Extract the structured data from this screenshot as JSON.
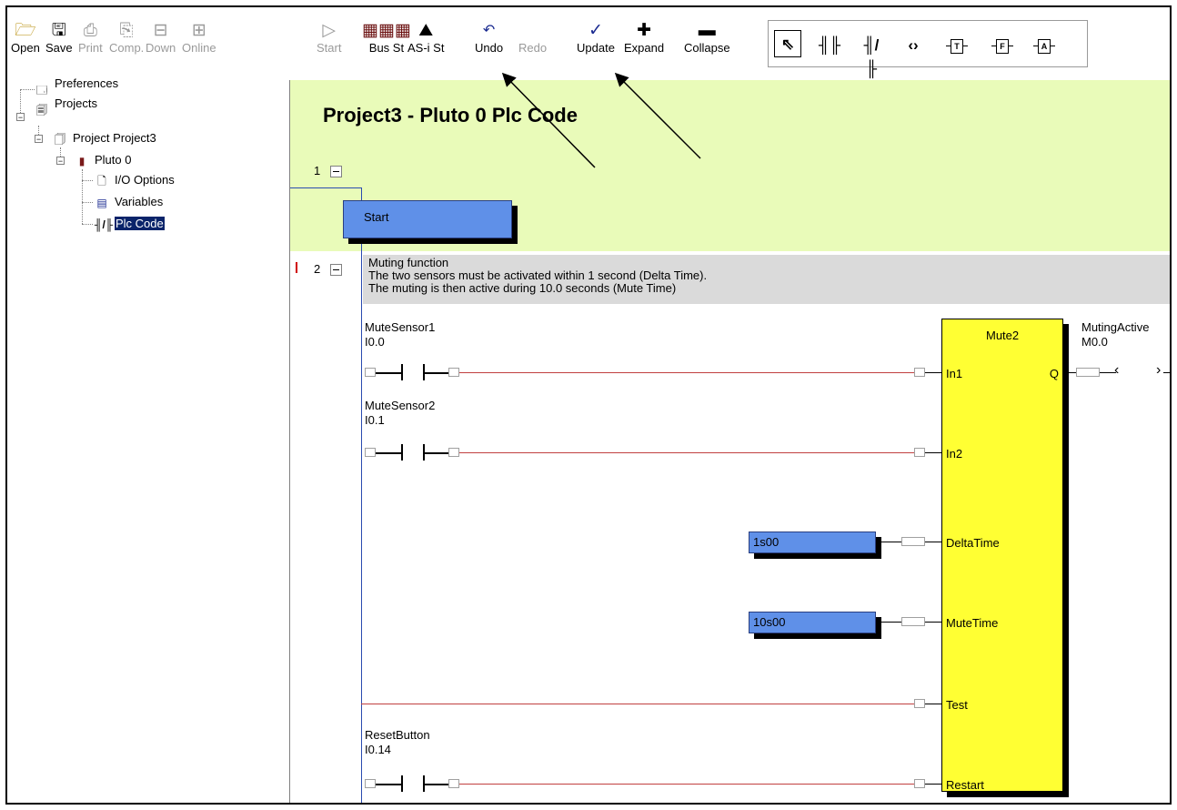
{
  "toolbar": {
    "buttons": [
      {
        "label": "Open",
        "icon": "folder-open-icon",
        "enabled": true
      },
      {
        "label": "Save",
        "icon": "floppy-disk-icon",
        "enabled": true
      },
      {
        "label": "Print",
        "icon": "printer-icon",
        "enabled": false
      },
      {
        "label": "Comp.",
        "icon": "compile-icon",
        "enabled": false
      },
      {
        "label": "Down",
        "icon": "download-icon",
        "enabled": false
      },
      {
        "label": "Online",
        "icon": "online-icon",
        "enabled": false
      },
      {
        "label": "Start",
        "icon": "play-icon",
        "enabled": false
      },
      {
        "label": "Bus St",
        "icon": "bus-status-icon",
        "enabled": true
      },
      {
        "label": "AS-i St",
        "icon": "asi-status-icon",
        "enabled": true
      },
      {
        "label": "Undo",
        "icon": "undo-icon",
        "enabled": true
      },
      {
        "label": "Redo",
        "icon": "redo-icon",
        "enabled": false
      },
      {
        "label": "Update",
        "icon": "checkmark-icon",
        "enabled": true
      },
      {
        "label": "Expand",
        "icon": "plus-icon",
        "enabled": true
      },
      {
        "label": "Collapse",
        "icon": "minus-icon",
        "enabled": true
      }
    ],
    "edit_tools": [
      {
        "name": "pointer-tool-icon",
        "glyph": "⇖"
      },
      {
        "name": "normally-open-contact-icon",
        "glyph": "┫┣"
      },
      {
        "name": "normally-closed-contact-icon",
        "glyph": "┫/┣"
      },
      {
        "name": "coil-icon",
        "glyph": "‹ ›"
      },
      {
        "name": "timer-block-icon",
        "glyph": "T"
      },
      {
        "name": "function-block-icon",
        "glyph": "F"
      },
      {
        "name": "action-block-icon",
        "glyph": "A"
      }
    ]
  },
  "tree": {
    "items": [
      {
        "label": "Preferences",
        "icon": "preferences-icon"
      },
      {
        "label": "Projects",
        "icon": "projects-icon"
      },
      {
        "label": "Project Project3",
        "icon": "project-icon"
      },
      {
        "label": "Pluto 0",
        "icon": "plc-device-icon"
      },
      {
        "label": "I/O Options",
        "icon": "document-icon"
      },
      {
        "label": "Variables",
        "icon": "variables-icon"
      },
      {
        "label": "Plc Code",
        "icon": "ladder-contact-icon",
        "selected": true
      }
    ]
  },
  "editor": {
    "title": "Project3 - Pluto 0 Plc Code",
    "rung1": {
      "number": "1",
      "block_label": "Start"
    },
    "rung2": {
      "number": "2",
      "comment": [
        "Muting function",
        "The two sensors must be activated within 1 second (Delta Time).",
        "The muting is then active during 10.0 seconds (Mute Time)"
      ],
      "contacts": [
        {
          "name": "MuteSensor1",
          "address": "I0.0"
        },
        {
          "name": "MuteSensor2",
          "address": "I0.1"
        },
        {
          "name": "ResetButton",
          "address": "I0.14"
        }
      ],
      "function_block": {
        "name": "Mute2",
        "inputs": [
          "In1",
          "In2",
          "DeltaTime",
          "MuteTime",
          "Test",
          "Restart"
        ],
        "output": "Q"
      },
      "constants": [
        {
          "value": "1s00"
        },
        {
          "value": "10s00"
        }
      ],
      "output_coil": {
        "name": "MutingActive",
        "address": "M0.0"
      }
    }
  },
  "colors": {
    "green_background": "#e9fbb9",
    "comment_background": "#dadada",
    "block_blue": "#5f90e8",
    "function_yellow": "#ffff33",
    "wire_red": "#c14040",
    "selection": "#0a246a"
  }
}
